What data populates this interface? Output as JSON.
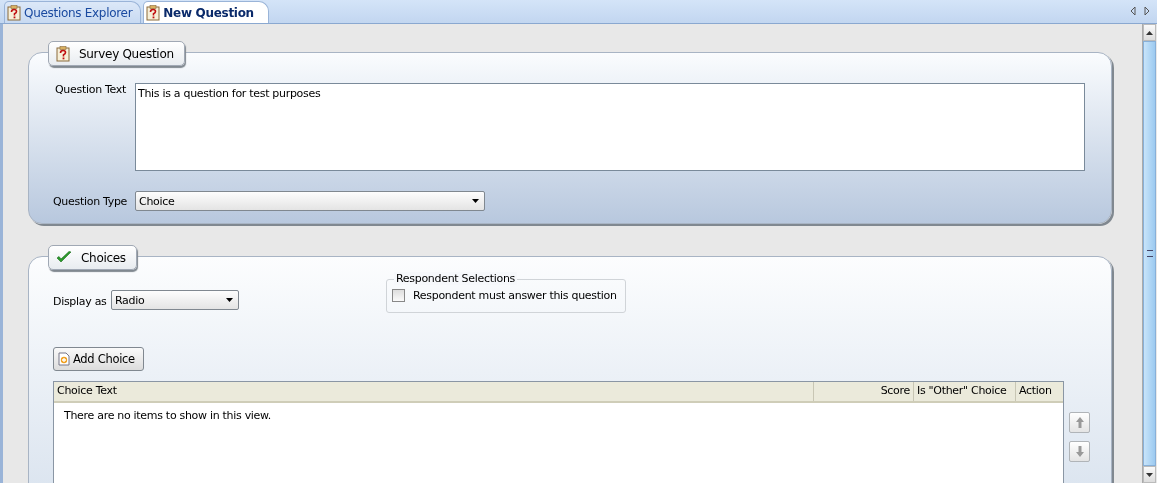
{
  "tabs": [
    {
      "label": "Questions Explorer",
      "selected": false
    },
    {
      "label": "New Question",
      "selected": true
    }
  ],
  "survey_question": {
    "title": "Survey Question",
    "question_text_label": "Question Text",
    "question_text": "This is a question for test purposes",
    "question_type_label": "Question Type",
    "question_type": "Choice"
  },
  "choices": {
    "title": "Choices",
    "display_as_label": "Display as",
    "display_as": "Radio",
    "respondent_selections": {
      "title": "Respondent Selections",
      "must_answer": {
        "label": "Respondent must answer this question",
        "checked": false
      }
    },
    "add_button": "Add Choice",
    "table": {
      "columns": [
        "Choice Text",
        "Score",
        "Is \"Other\" Choice",
        "Action"
      ],
      "empty_message": "There are no items to show in this view."
    }
  }
}
